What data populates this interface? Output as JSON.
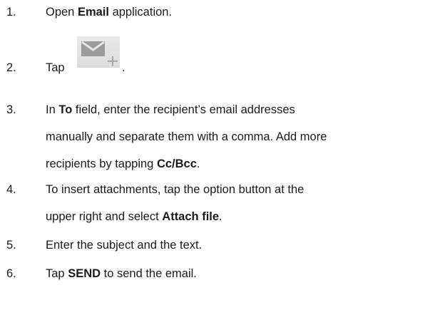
{
  "steps": [
    {
      "number": "1.",
      "lines": [
        [
          {
            "text": "Open ",
            "bold": false
          },
          {
            "text": "Email",
            "bold": true
          },
          {
            "text": " application.",
            "bold": false
          }
        ]
      ]
    },
    {
      "number": "2.",
      "lines": [
        [
          {
            "text": "Tap",
            "bold": false
          },
          {
            "text": ".",
            "bold": false
          }
        ]
      ],
      "icon": "compose-email-icon"
    },
    {
      "number": "3.",
      "lines": [
        [
          {
            "text": "In ",
            "bold": false
          },
          {
            "text": "To",
            "bold": true
          },
          {
            "text": " field, enter the recipient’s email addresses",
            "bold": false
          }
        ],
        [
          {
            "text": "manually and separate them with a comma. Add more",
            "bold": false
          }
        ],
        [
          {
            "text": "recipients by tapping ",
            "bold": false
          },
          {
            "text": "Cc/Bcc",
            "bold": true
          },
          {
            "text": ".",
            "bold": false
          }
        ]
      ]
    },
    {
      "number": "4.",
      "lines": [
        [
          {
            "text": "To insert attachments, tap the option button at the",
            "bold": false
          }
        ],
        [
          {
            "text": "upper right and select ",
            "bold": false
          },
          {
            "text": "Attach file",
            "bold": true
          },
          {
            "text": ".",
            "bold": false
          }
        ]
      ]
    },
    {
      "number": "5.",
      "lines": [
        [
          {
            "text": "Enter the subject and the text.",
            "bold": false
          }
        ]
      ]
    },
    {
      "number": "6.",
      "lines": [
        [
          {
            "text": "Tap ",
            "bold": false
          },
          {
            "text": "SEND",
            "bold": true
          },
          {
            "text": " to send the email.",
            "bold": false
          }
        ]
      ]
    }
  ]
}
